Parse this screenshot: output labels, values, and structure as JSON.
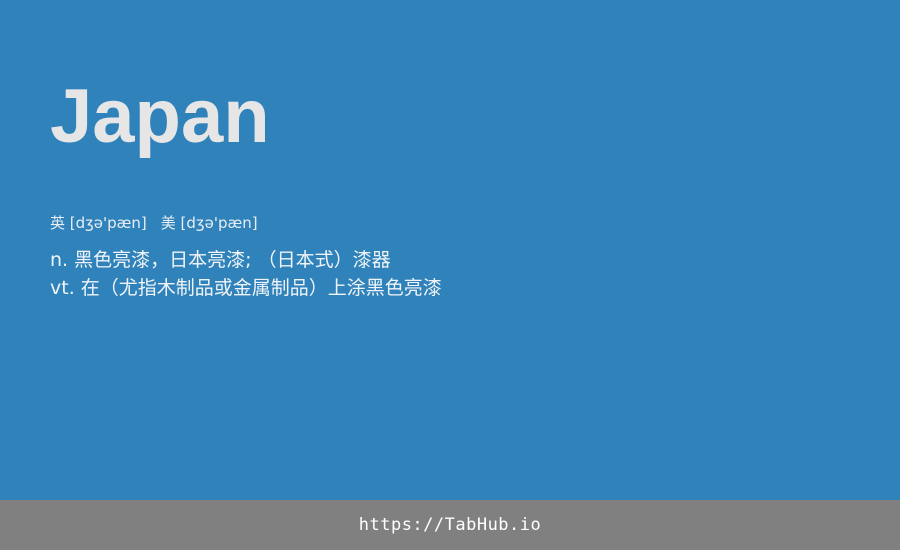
{
  "headword": "Japan",
  "phonetics": {
    "uk": "英 [dʒə'pæn]",
    "us": "美 [dʒə'pæn]"
  },
  "definitions": [
    "n. 黑色亮漆，日本亮漆; （日本式）漆器",
    "vt. 在（尤指木制品或金属制品）上涂黑色亮漆"
  ],
  "footer": {
    "url": "https://TabHub.io"
  },
  "colors": {
    "background": "#3082ba",
    "footer_background": "#808080",
    "headword": "#e6e6e6",
    "text": "#f0f4f8"
  }
}
